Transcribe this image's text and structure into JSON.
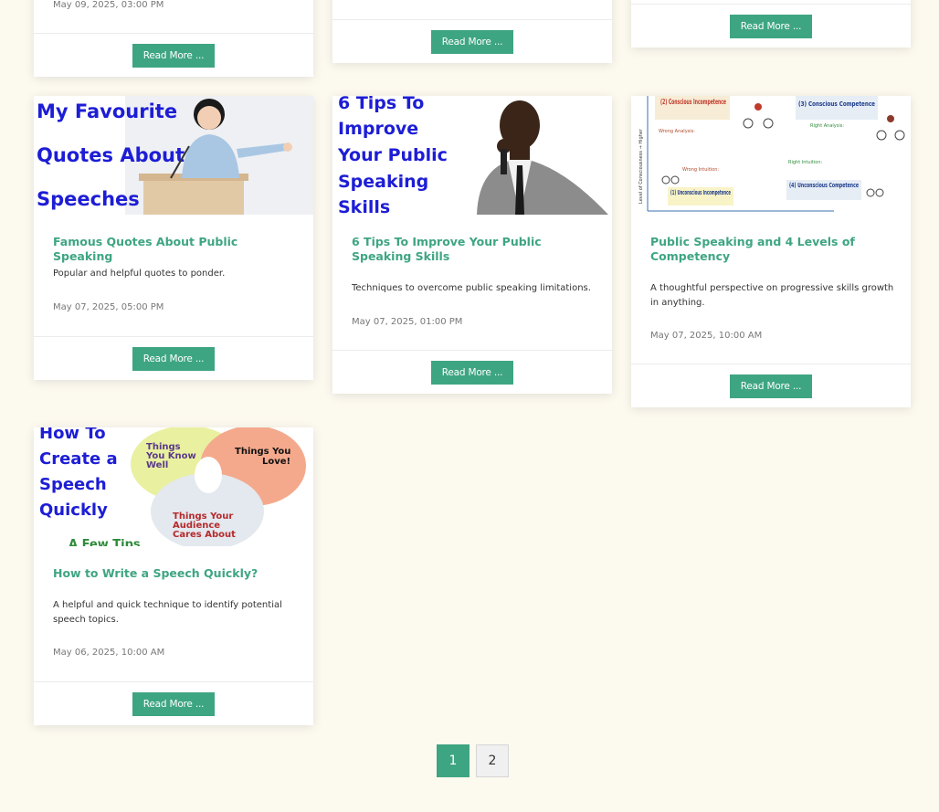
{
  "top_cards": [
    {
      "date": "May 09, 2025, 03:00 PM",
      "button": "Read More ..."
    },
    {
      "button": "Read More ..."
    },
    {
      "button": "Read More ..."
    }
  ],
  "posts": [
    {
      "title": "Famous Quotes About Public Speaking",
      "excerpt": "Popular and helpful quotes to ponder.",
      "date": "May 07, 2025, 05:00 PM",
      "button": "Read More ...",
      "thumb_text": [
        "My Favourite",
        "Quotes About",
        "Speeches"
      ]
    },
    {
      "title": "6 Tips To Improve Your Public Speaking Skills",
      "excerpt": "Techniques to overcome public speaking limitations.",
      "date": "May 07, 2025, 01:00 PM",
      "button": "Read More ...",
      "thumb_text": [
        "6 Tips To",
        "Improve",
        "Your Public",
        "Speaking",
        "Skills"
      ]
    },
    {
      "title": "Public Speaking and 4 Levels of Competency",
      "excerpt": "A thoughtful perspective on progressive skills growth in anything.",
      "date": "May 07, 2025, 10:00 AM",
      "button": "Read More ...",
      "thumb_text": {
        "l2": "(2) Conscious Incompetence",
        "l3": "(3) Conscious Competence",
        "l1": "(1) Unconscious Incompetence",
        "l4": "(4) Unconscious Competence",
        "wrong_analysis": "Wrong Analysis:",
        "right_analysis": "Right Analysis:",
        "wrong_intuition": "Wrong Intuition:",
        "right_intuition": "Right Intuition:",
        "axis": "Level of Consciousness → Higher"
      }
    },
    {
      "title": "How to Write a Speech Quickly?",
      "excerpt": "A helpful and quick technique to identify potential speech topics.",
      "date": "May 06, 2025, 10:00 AM",
      "button": "Read More ...",
      "thumb_text": {
        "heading": [
          "How To",
          "Create a",
          "Speech",
          "Quickly"
        ],
        "subheading": "A Few Tips",
        "circle1": [
          "Things",
          "You Know",
          "Well"
        ],
        "circle2": [
          "Things You",
          "Love!"
        ],
        "circle3": [
          "Things Your",
          "Audience",
          "Cares About"
        ]
      }
    }
  ],
  "pagination": [
    "1",
    "2"
  ],
  "colors": {
    "accent": "#3ea582",
    "background": "#fcf9ef"
  }
}
